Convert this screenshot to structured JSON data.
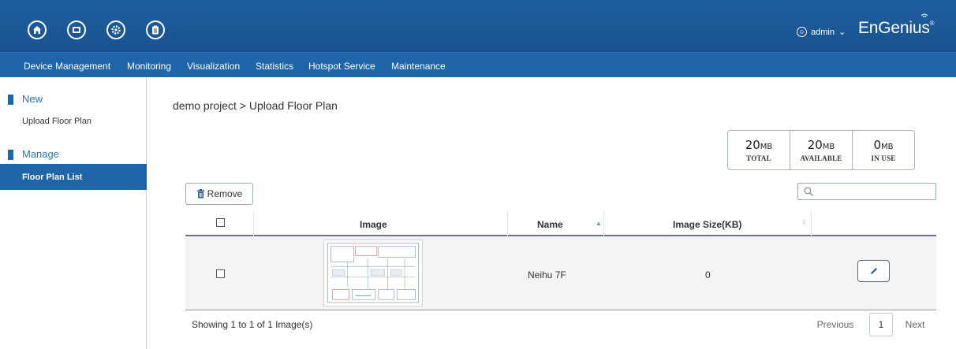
{
  "header": {
    "icons": [
      "home-icon",
      "dashboard-icon",
      "settings-icon",
      "clipboard-icon"
    ],
    "user_label": "admin",
    "user_caret": "⌄",
    "brand": "EnGenius"
  },
  "nav": {
    "items": [
      "Device Management",
      "Monitoring",
      "Visualization",
      "Statistics",
      "Hotspot Service",
      "Maintenance"
    ]
  },
  "sidebar": {
    "new_section": "New",
    "upload_item": "Upload Floor Plan",
    "manage_section": "Manage",
    "list_item": "Floor Plan List"
  },
  "page": {
    "breadcrumb": "demo project > Upload Floor Plan"
  },
  "storage": {
    "total_value": "20",
    "total_unit": "MB",
    "total_label": "TOTAL",
    "available_value": "20",
    "available_unit": "MB",
    "available_label": "AVAILABLE",
    "inuse_value": "0",
    "inuse_unit": "MB",
    "inuse_label": "IN USE"
  },
  "toolbar": {
    "remove_label": "Remove",
    "search_placeholder": ""
  },
  "table": {
    "columns": {
      "image": "Image",
      "name": "Name",
      "size": "Image Size(KB)"
    },
    "rows": [
      {
        "name": "Neihu 7F",
        "size": "0"
      }
    ]
  },
  "footer": {
    "info": "Showing 1 to 1 of 1 Image(s)",
    "previous": "Previous",
    "page": "1",
    "next": "Next"
  },
  "colors": {
    "header_bg": "#1a5290",
    "nav_bg": "#1e65aa",
    "accent": "#2c74b5"
  }
}
